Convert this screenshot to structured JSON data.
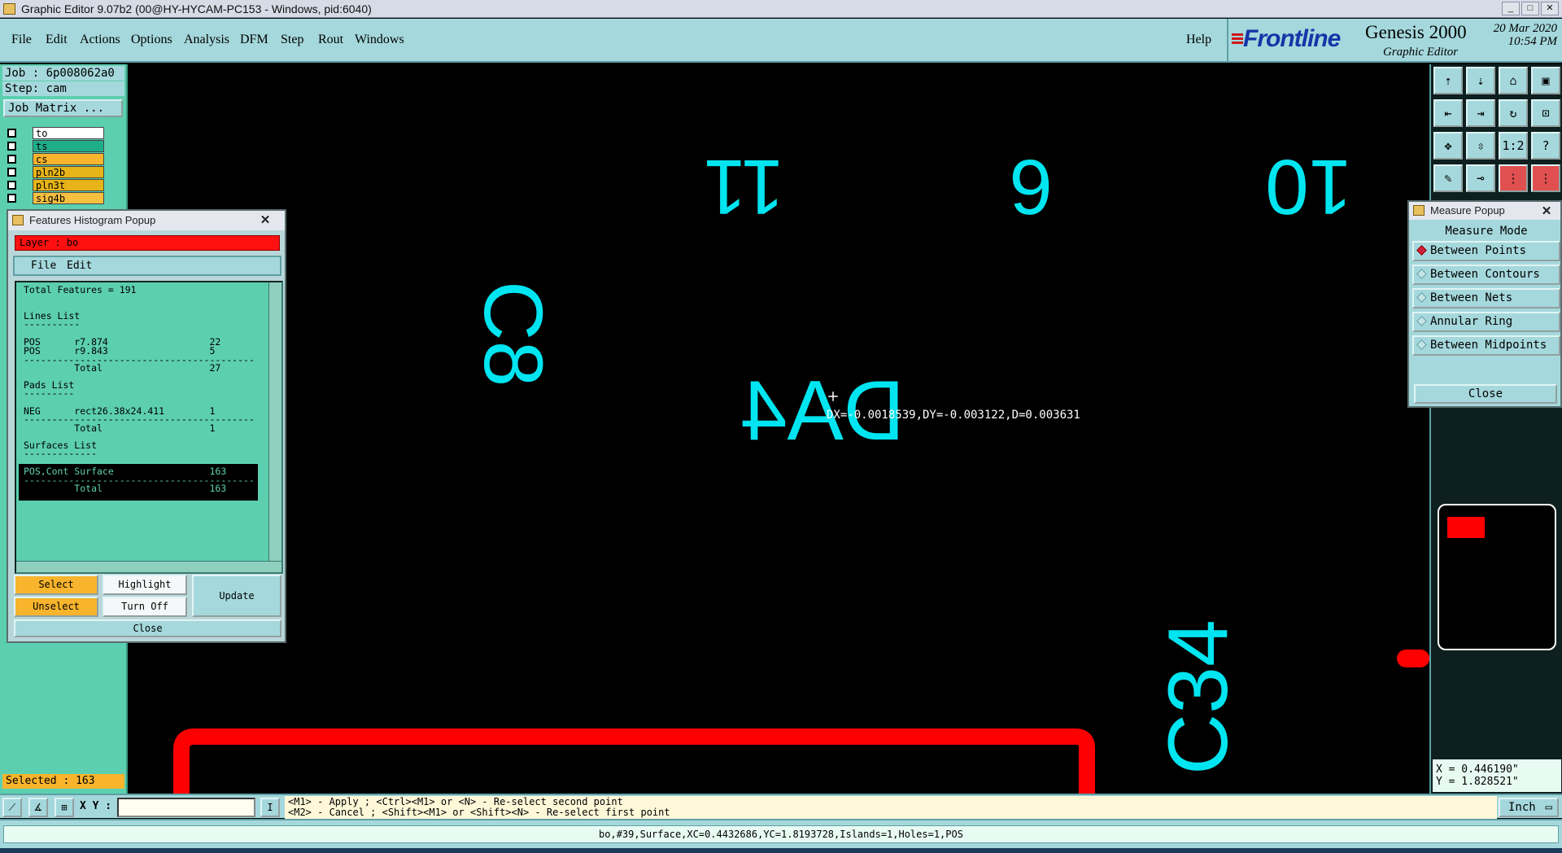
{
  "window": {
    "title": "Graphic Editor 9.07b2 (00@HY-HYCAM-PC153 - Windows, pid:6040)"
  },
  "menu": {
    "items": [
      "File",
      "Edit",
      "Actions",
      "Options",
      "Analysis",
      "DFM",
      "Step",
      "Rout",
      "Windows"
    ],
    "help": "Help"
  },
  "logo": {
    "brand": "Frontline",
    "product": "Genesis 2000",
    "sub": "Graphic Editor",
    "date": "20 Mar 2020",
    "time": "10:54 PM"
  },
  "left": {
    "job": "Job : 6p008062a0",
    "step": "Step: cam",
    "job_matrix": "Job Matrix ...",
    "layers": [
      {
        "name": "to",
        "color": "#ffffff"
      },
      {
        "name": "ts",
        "color": "#1fae8a"
      },
      {
        "name": "cs",
        "color": "#f7b42c"
      },
      {
        "name": "pln2b",
        "color": "#e6b418"
      },
      {
        "name": "pln3t",
        "color": "#e6b418"
      },
      {
        "name": "sig4b",
        "color": "#f7c040"
      }
    ],
    "selected": "Selected : 163"
  },
  "histogram": {
    "title": "Features Histogram Popup",
    "layer": "Layer :  bo",
    "menu": [
      "File",
      "Edit"
    ],
    "lines": [
      "Total Features = 191",
      "",
      "Lines List",
      "----------",
      "POS      r7.874                  22",
      "POS      r9.843                  5",
      "-----------------------------------------",
      "         Total                   27",
      "Pads List",
      "---------",
      "NEG      rect26.38x24.411        1",
      "-----------------------------------------",
      "         Total                   1",
      "Surfaces List",
      "-------------",
      "POS,Cont Surface                 163",
      "-----------------------------------------",
      "         Total                   163"
    ],
    "buttons": {
      "select": "Select",
      "highlight": "Highlight",
      "unselect": "Unselect",
      "turn_off": "Turn Off",
      "update": "Update",
      "close": "Close"
    }
  },
  "canvas": {
    "labels": [
      "11",
      "6",
      "10",
      "C8",
      "DA4",
      "C34"
    ],
    "measure_text": "DX=-0.0018539,DY=-0.003122,D=0.003631",
    "text_color": "#00e5f0",
    "feature_color": "#ff0000"
  },
  "measure": {
    "title": "Measure Popup",
    "header": "Measure Mode",
    "options": [
      {
        "label": "Between Points",
        "selected": true
      },
      {
        "label": "Between Contours",
        "selected": false
      },
      {
        "label": "Between Nets",
        "selected": false
      },
      {
        "label": "Annular Ring",
        "selected": false
      },
      {
        "label": "Between Midpoints",
        "selected": false
      }
    ],
    "close": "Close"
  },
  "toolbar": {
    "icons": [
      "home-top-icon",
      "home-down-icon",
      "home-icon",
      "window-icon",
      "pan-left-icon",
      "pan-right-icon",
      "redraw-icon",
      "zoom-icon",
      "fit-icon",
      "center-icon",
      "scale-1-2-icon",
      "help-icon",
      "tool-icon",
      "measure-icon",
      "snap-icon",
      "snap2-icon"
    ],
    "scale_label": "1:2",
    "help_label": "?"
  },
  "coords": {
    "x": "X = 0.446190\"",
    "y": "Y = 1.828521\""
  },
  "command": {
    "xy_label": "X Y :",
    "hint1": "<M1> - Apply  ; <Ctrl><M1> or <N> - Re-select second point",
    "hint2": "<M2> - Cancel ; <Shift><M1> or <Shift><N> - Re-select first point",
    "unit": "Inch"
  },
  "status": {
    "text": "bo,#39,Surface,XC=0.4432686,YC=1.8193728,Islands=1,Holes=1,POS"
  }
}
